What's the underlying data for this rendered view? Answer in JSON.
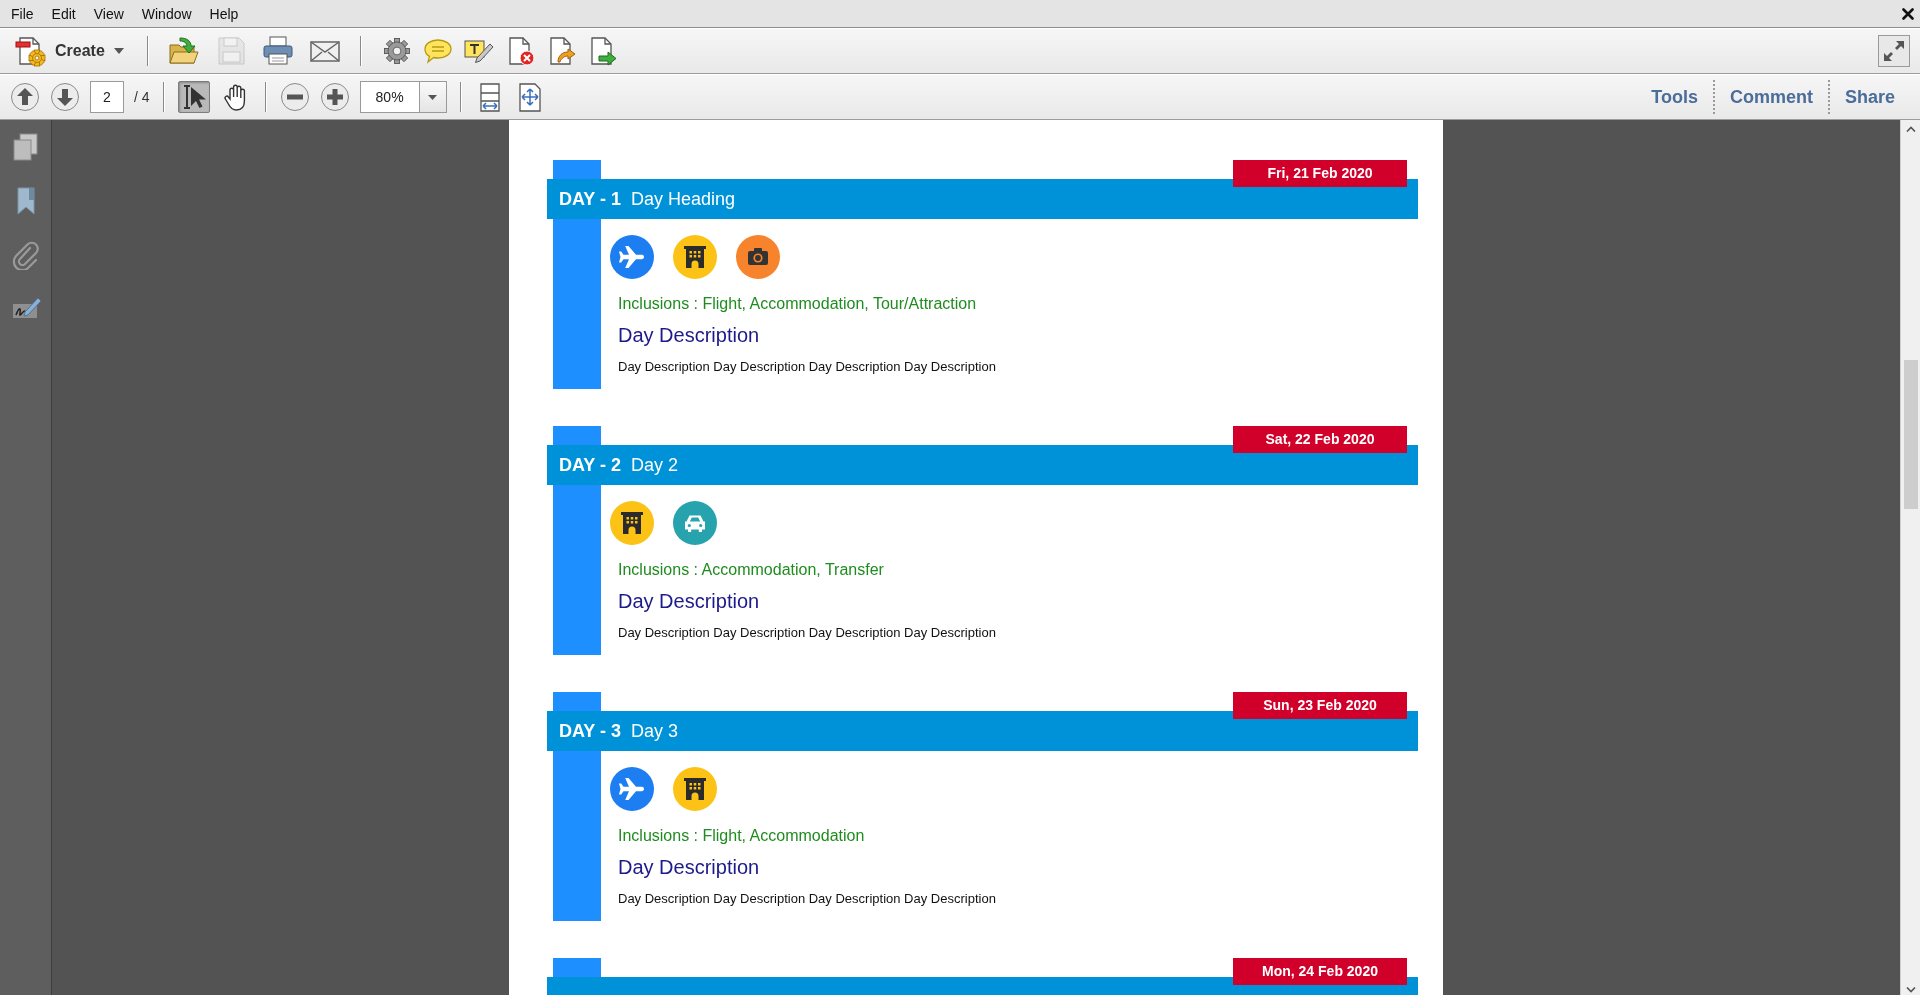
{
  "menu_bar": {
    "items": [
      "File",
      "Edit",
      "View",
      "Window",
      "Help"
    ]
  },
  "toolbar": {
    "create": {
      "label": "Create"
    },
    "groups": [
      [
        {
          "kind": "open",
          "disabled": false
        },
        {
          "kind": "save",
          "disabled": true
        },
        {
          "kind": "print",
          "disabled": false
        },
        {
          "kind": "email",
          "disabled": false
        }
      ],
      [
        {
          "kind": "settings",
          "disabled": false
        },
        {
          "kind": "comment",
          "disabled": false
        },
        {
          "kind": "markup",
          "disabled": false
        },
        {
          "kind": "delete-doc",
          "disabled": false
        },
        {
          "kind": "export-doc",
          "disabled": false
        },
        {
          "kind": "send-doc",
          "disabled": false
        }
      ]
    ]
  },
  "navigation_bar": {
    "page_buttons": [
      {
        "kind": "previous"
      },
      {
        "kind": "next"
      }
    ],
    "page": {
      "value": "2"
    },
    "page_total": "/ 4",
    "tools": [
      {
        "kind": "select",
        "selected": true
      },
      {
        "kind": "hand",
        "selected": false
      }
    ],
    "zoom_buttons": [
      {
        "kind": "zoom-out"
      },
      {
        "kind": "zoom-in"
      }
    ],
    "zoom": {
      "value": "80%"
    },
    "view_buttons": [
      {
        "kind": "fit-width"
      },
      {
        "kind": "fit-page"
      }
    ],
    "panes": [
      {
        "label": "Tools"
      },
      {
        "label": "Comment"
      },
      {
        "label": "Share"
      }
    ]
  },
  "sidebar": {
    "items": [
      {
        "kind": "pages"
      },
      {
        "kind": "bookmarks"
      },
      {
        "kind": "attachments"
      },
      {
        "kind": "signatures"
      }
    ]
  },
  "days": [
    {
      "day_label": "DAY - 1",
      "heading": "Day Heading",
      "date": "Fri, 21 Feb 2020",
      "inclusion_icons": [
        {
          "kind": "flight"
        },
        {
          "kind": "accommodation"
        },
        {
          "kind": "tour"
        }
      ],
      "inclusions": "Inclusions : Flight, Accommodation, Tour/Attraction",
      "description_title": "Day Description",
      "description": "Day Description Day Description Day Description Day Description"
    },
    {
      "day_label": "DAY - 2",
      "heading": "Day 2",
      "date": "Sat, 22 Feb 2020",
      "inclusion_icons": [
        {
          "kind": "accommodation"
        },
        {
          "kind": "transfer"
        }
      ],
      "inclusions": "Inclusions : Accommodation, Transfer",
      "description_title": "Day Description",
      "description": "Day Description Day Description Day Description Day Description"
    },
    {
      "day_label": "DAY - 3",
      "heading": "Day 3",
      "date": "Sun, 23 Feb 2020",
      "inclusion_icons": [
        {
          "kind": "flight"
        },
        {
          "kind": "accommodation"
        }
      ],
      "inclusions": "Inclusions : Flight, Accommodation",
      "description_title": "Day Description",
      "description": "Day Description Day Description Day Description Day Description"
    },
    {
      "date": "Mon, 24 Feb 2020"
    }
  ]
}
